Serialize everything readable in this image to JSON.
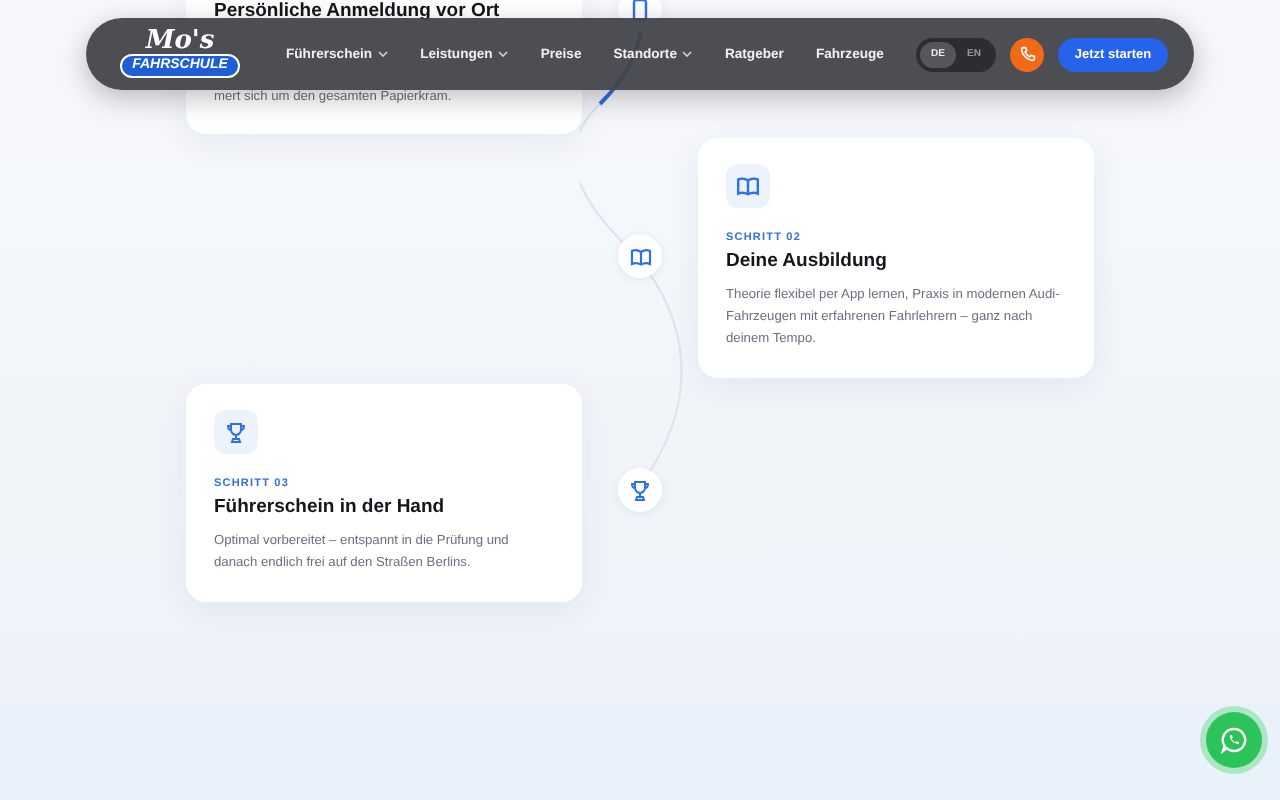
{
  "nav": {
    "logo": {
      "script": "Mo's",
      "badge": "FAHRSCHULE"
    },
    "items": [
      {
        "label": "Führerschein",
        "dropdown": true
      },
      {
        "label": "Leistungen",
        "dropdown": true
      },
      {
        "label": "Preise",
        "dropdown": false
      },
      {
        "label": "Standorte",
        "dropdown": true
      },
      {
        "label": "Ratgeber",
        "dropdown": false
      },
      {
        "label": "Fahrzeuge",
        "dropdown": false
      }
    ],
    "languages": [
      {
        "label": "DE",
        "selected": true
      },
      {
        "label": "EN",
        "selected": false
      }
    ],
    "cta": "Jetzt starten"
  },
  "steps": [
    {
      "kind": "phone",
      "title": "Persönliche Anmeldung vor Ort",
      "description": "mert sich um den gesamten Papierkram."
    },
    {
      "kind": "book",
      "label": "SCHRITT 02",
      "title": "Deine Ausbildung",
      "description": "Theorie flexibel per App lernen, Praxis in modernen Audi-Fahrzeugen mit erfahrenen Fahrlehrern – ganz nach deinem Tempo."
    },
    {
      "kind": "trophy",
      "label": "SCHRITT 03",
      "title": "Führerschein in der Hand",
      "description": "Optimal vorbereitet – entspannt in die Prüfung und danach endlich frei auf den Straßen Berlins."
    }
  ]
}
